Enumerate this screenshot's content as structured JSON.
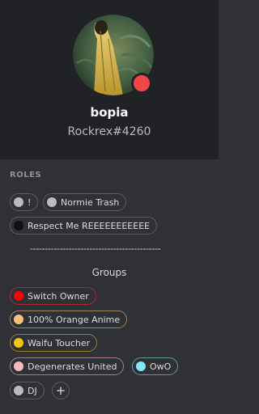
{
  "profile": {
    "username": "bopia",
    "tag": "Rockrex#4260",
    "status_color": "#f04747"
  },
  "roles": {
    "title": "ROLES",
    "items": [
      {
        "label": "!",
        "color": "#b9bbbe"
      },
      {
        "label": "Normie Trash",
        "color": "#b9bbbe"
      },
      {
        "label": "Respect Me REEEEEEEEEEE",
        "color": "#111111"
      }
    ],
    "divider": "--------------------------------------------",
    "groups_title": "Groups",
    "groups": [
      {
        "label": "Switch Owner",
        "color": "#ff0000",
        "border": "#b0292b"
      },
      {
        "label": "100% Orange Anime",
        "color": "#f8c079",
        "border": "#a2835a"
      },
      {
        "label": "Waifu Toucher",
        "color": "#f1c40f",
        "border": "#9a8322"
      },
      {
        "label": "Degenerates United",
        "color": "#f7b7bd",
        "border": "#9f8286"
      },
      {
        "label": "OwO",
        "color": "#84e7f7",
        "border": "#5d9aa3"
      },
      {
        "label": "DJ",
        "color": "#b9bbbe",
        "border": "#5a5d63"
      }
    ],
    "add_icon": "plus-icon"
  }
}
